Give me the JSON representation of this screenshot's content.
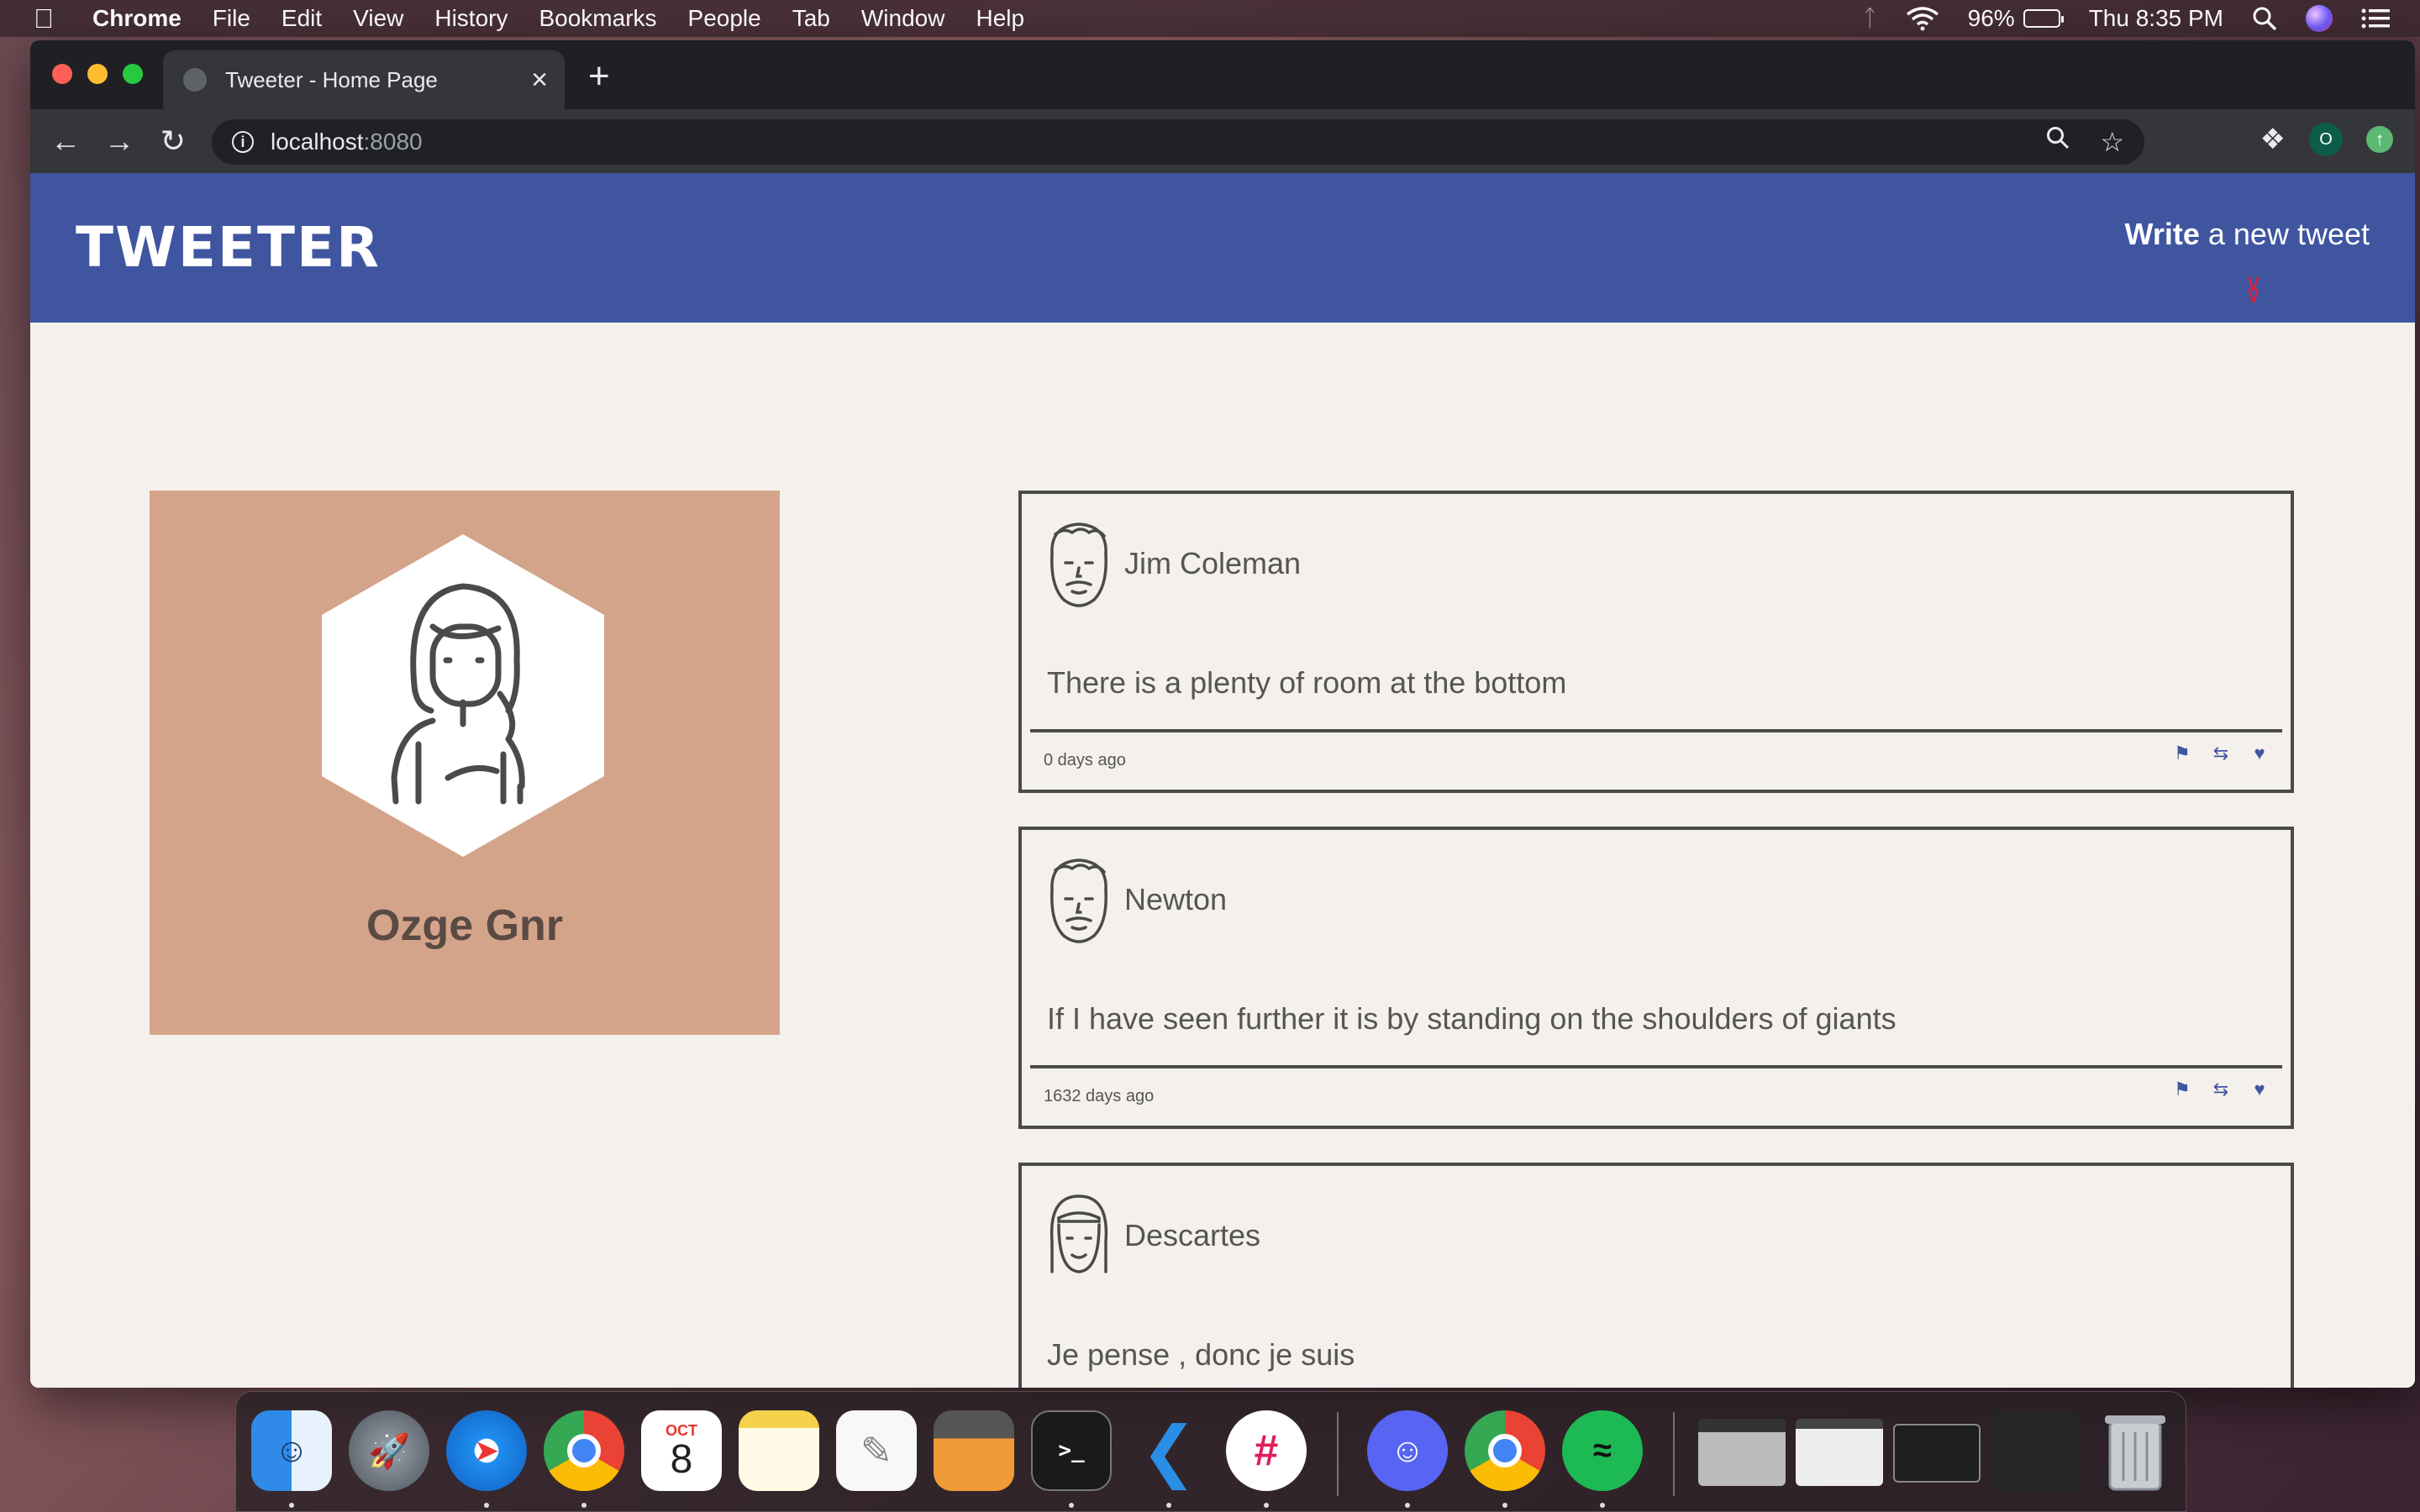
{
  "menubar": {
    "app_name": "Chrome",
    "items": [
      "File",
      "Edit",
      "View",
      "History",
      "Bookmarks",
      "People",
      "Tab",
      "Window",
      "Help"
    ],
    "battery": "96%",
    "clock": "Thu 8:35 PM"
  },
  "browser": {
    "tab_title": "Tweeter - Home Page",
    "url_host": "localhost",
    "url_port": ":8080",
    "profile_initial": "O"
  },
  "site": {
    "brand": "TWEETER",
    "compose_strong": "Write",
    "compose_rest": " a new tweet"
  },
  "profile": {
    "name": "Ozge Gnr",
    "card_color": "#d4a48a"
  },
  "tweets": [
    {
      "author": "Jim Coleman",
      "content": "There is a plenty of room at the bottom",
      "age": "0 days ago"
    },
    {
      "author": "Newton",
      "content": "If I have seen further it is by standing on the shoulders of giants",
      "age": "1632 days ago"
    },
    {
      "author": "Descartes",
      "content": "Je pense , donc je suis",
      "age": ""
    }
  ],
  "dock": {
    "calendar_month": "OCT",
    "calendar_day": "8",
    "apps": [
      "Finder",
      "Launchpad",
      "Safari",
      "Chrome",
      "Calendar",
      "Notes",
      "TextEdit",
      "Calculator",
      "Terminal",
      "VS Code",
      "Slack",
      "Discord",
      "Chrome",
      "Spotify",
      "Trash"
    ]
  },
  "colors": {
    "nav_blue": "#3f55a0",
    "accent_red": "#d8223f",
    "page_bg": "#f4f1ec"
  }
}
